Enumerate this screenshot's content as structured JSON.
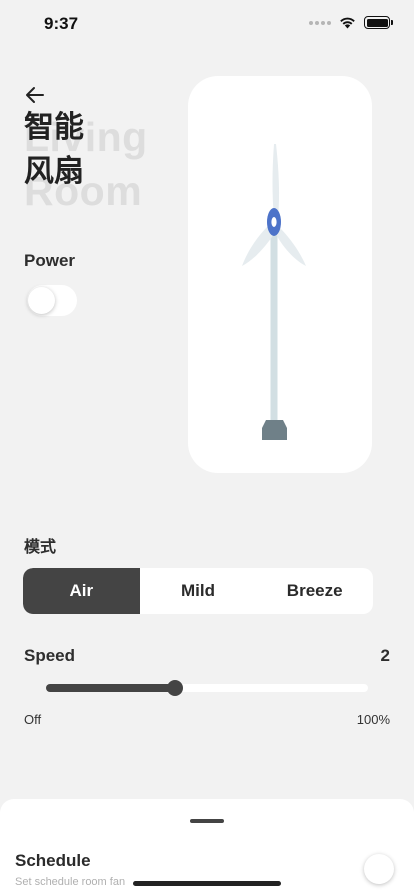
{
  "status_bar": {
    "time": "9:37",
    "icons": [
      "signal-dots-icon",
      "wifi-icon",
      "battery-icon"
    ]
  },
  "header": {
    "back_icon": "arrow-left-icon",
    "title": "智能\n风扇",
    "ghost_title": "Living\nRoom"
  },
  "power": {
    "label": "Power",
    "on": false
  },
  "fan": {
    "illustration": "wind-turbine-fan-icon",
    "colors": {
      "blade": "#e6ecef",
      "pole": "#d2dfe3",
      "hub": "#4d73c9",
      "base": "#6f8088"
    }
  },
  "mode": {
    "label": "模式",
    "options": [
      "Air",
      "Mild",
      "Breeze"
    ],
    "selected": "Air"
  },
  "speed": {
    "label": "Speed",
    "value": "2",
    "fraction": 0.4,
    "min_label": "Off",
    "max_label": "100%"
  },
  "schedule": {
    "title": "Schedule",
    "subtitle": "Set schedule room fan",
    "on": false
  },
  "colors": {
    "background": "#f2f2f2",
    "accent": "#444444",
    "card": "#ffffff"
  }
}
